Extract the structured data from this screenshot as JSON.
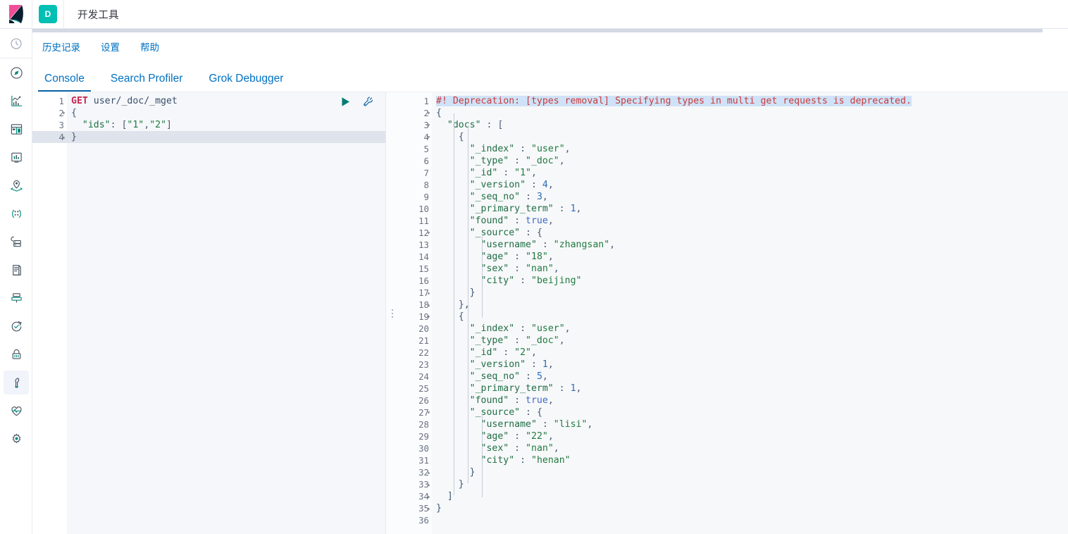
{
  "header": {
    "logo_icon": "kibana-logo",
    "app_badge": "D",
    "title": "开发工具"
  },
  "rail": {
    "items": [
      {
        "icon": "clock-icon",
        "name": "recently-viewed"
      },
      {
        "icon": "compass-icon",
        "name": "discover"
      },
      {
        "icon": "line-chart-icon",
        "name": "visualize"
      },
      {
        "icon": "dashboard-icon",
        "name": "dashboard"
      },
      {
        "icon": "canvas-icon",
        "name": "canvas"
      },
      {
        "icon": "maps-icon",
        "name": "maps"
      },
      {
        "icon": "ml-icon",
        "name": "machine-learning"
      },
      {
        "icon": "infrastructure-icon",
        "name": "infrastructure"
      },
      {
        "icon": "logs-icon",
        "name": "logs"
      },
      {
        "icon": "apm-icon",
        "name": "apm"
      },
      {
        "icon": "uptime-icon",
        "name": "uptime"
      },
      {
        "icon": "lock-icon",
        "name": "security"
      },
      {
        "icon": "wrench-icon",
        "name": "dev-tools",
        "active": true
      },
      {
        "icon": "heartbeat-icon",
        "name": "stack-monitoring"
      },
      {
        "icon": "gear-icon",
        "name": "management"
      }
    ]
  },
  "navlinks": [
    {
      "label": "历史记录",
      "name": "history-link"
    },
    {
      "label": "设置",
      "name": "settings-link"
    },
    {
      "label": "帮助",
      "name": "help-link"
    }
  ],
  "tabs": [
    {
      "label": "Console",
      "name": "tab-console",
      "active": true
    },
    {
      "label": "Search Profiler",
      "name": "tab-search-profiler",
      "active": false
    },
    {
      "label": "Grok Debugger",
      "name": "tab-grok-debugger",
      "active": false
    }
  ],
  "actions": {
    "run_label": "play-icon",
    "wrench_label": "wrench-icon"
  },
  "request_editor": {
    "name": "request-editor",
    "active_line": 4,
    "lines": [
      {
        "n": 1,
        "fold": "",
        "tokens": [
          {
            "t": "method",
            "v": "GET"
          },
          {
            "t": "url",
            "v": " user/_doc/_mget"
          }
        ]
      },
      {
        "n": 2,
        "fold": "▾",
        "tokens": [
          {
            "t": "brace",
            "v": "{"
          }
        ]
      },
      {
        "n": 3,
        "fold": "",
        "tokens": [
          {
            "t": "punc",
            "v": "  "
          },
          {
            "t": "key",
            "v": "\"ids\""
          },
          {
            "t": "punc",
            "v": ": ["
          },
          {
            "t": "str",
            "v": "\"1\""
          },
          {
            "t": "punc",
            "v": ","
          },
          {
            "t": "str",
            "v": "\"2\""
          },
          {
            "t": "punc",
            "v": "]"
          }
        ]
      },
      {
        "n": 4,
        "fold": "▴",
        "tokens": [
          {
            "t": "brace",
            "v": "}"
          }
        ]
      }
    ]
  },
  "response_editor": {
    "name": "response-editor",
    "selected_line": 1,
    "lines": [
      {
        "n": 1,
        "fold": "",
        "sel": true,
        "tokens": [
          {
            "t": "depr",
            "v": "#! Deprecation: [types removal] Specifying types in multi get requests is deprecated."
          }
        ]
      },
      {
        "n": 2,
        "fold": "▾",
        "tokens": [
          {
            "t": "brace",
            "v": "{"
          }
        ]
      },
      {
        "n": 3,
        "fold": "▾",
        "tokens": [
          {
            "t": "punc",
            "v": "  "
          },
          {
            "t": "key",
            "v": "\"docs\""
          },
          {
            "t": "punc",
            "v": " : ["
          }
        ]
      },
      {
        "n": 4,
        "fold": "▾",
        "tokens": [
          {
            "t": "punc",
            "v": "    "
          },
          {
            "t": "brace",
            "v": "{"
          }
        ]
      },
      {
        "n": 5,
        "fold": "",
        "tokens": [
          {
            "t": "punc",
            "v": "      "
          },
          {
            "t": "key",
            "v": "\"_index\""
          },
          {
            "t": "punc",
            "v": " : "
          },
          {
            "t": "str",
            "v": "\"user\""
          },
          {
            "t": "punc",
            "v": ","
          }
        ]
      },
      {
        "n": 6,
        "fold": "",
        "tokens": [
          {
            "t": "punc",
            "v": "      "
          },
          {
            "t": "key",
            "v": "\"_type\""
          },
          {
            "t": "punc",
            "v": " : "
          },
          {
            "t": "str",
            "v": "\"_doc\""
          },
          {
            "t": "punc",
            "v": ","
          }
        ]
      },
      {
        "n": 7,
        "fold": "",
        "tokens": [
          {
            "t": "punc",
            "v": "      "
          },
          {
            "t": "key",
            "v": "\"_id\""
          },
          {
            "t": "punc",
            "v": " : "
          },
          {
            "t": "str",
            "v": "\"1\""
          },
          {
            "t": "punc",
            "v": ","
          }
        ]
      },
      {
        "n": 8,
        "fold": "",
        "tokens": [
          {
            "t": "punc",
            "v": "      "
          },
          {
            "t": "key",
            "v": "\"_version\""
          },
          {
            "t": "punc",
            "v": " : "
          },
          {
            "t": "num",
            "v": "4"
          },
          {
            "t": "punc",
            "v": ","
          }
        ]
      },
      {
        "n": 9,
        "fold": "",
        "tokens": [
          {
            "t": "punc",
            "v": "      "
          },
          {
            "t": "key",
            "v": "\"_seq_no\""
          },
          {
            "t": "punc",
            "v": " : "
          },
          {
            "t": "num",
            "v": "3"
          },
          {
            "t": "punc",
            "v": ","
          }
        ]
      },
      {
        "n": 10,
        "fold": "",
        "tokens": [
          {
            "t": "punc",
            "v": "      "
          },
          {
            "t": "key",
            "v": "\"_primary_term\""
          },
          {
            "t": "punc",
            "v": " : "
          },
          {
            "t": "num",
            "v": "1"
          },
          {
            "t": "punc",
            "v": ","
          }
        ]
      },
      {
        "n": 11,
        "fold": "",
        "tokens": [
          {
            "t": "punc",
            "v": "      "
          },
          {
            "t": "key",
            "v": "\"found\""
          },
          {
            "t": "punc",
            "v": " : "
          },
          {
            "t": "bool",
            "v": "true"
          },
          {
            "t": "punc",
            "v": ","
          }
        ]
      },
      {
        "n": 12,
        "fold": "▾",
        "tokens": [
          {
            "t": "punc",
            "v": "      "
          },
          {
            "t": "key",
            "v": "\"_source\""
          },
          {
            "t": "punc",
            "v": " : "
          },
          {
            "t": "brace",
            "v": "{"
          }
        ]
      },
      {
        "n": 13,
        "fold": "",
        "tokens": [
          {
            "t": "punc",
            "v": "        "
          },
          {
            "t": "key",
            "v": "\"username\""
          },
          {
            "t": "punc",
            "v": " : "
          },
          {
            "t": "str",
            "v": "\"zhangsan\""
          },
          {
            "t": "punc",
            "v": ","
          }
        ]
      },
      {
        "n": 14,
        "fold": "",
        "tokens": [
          {
            "t": "punc",
            "v": "        "
          },
          {
            "t": "key",
            "v": "\"age\""
          },
          {
            "t": "punc",
            "v": " : "
          },
          {
            "t": "str",
            "v": "\"18\""
          },
          {
            "t": "punc",
            "v": ","
          }
        ]
      },
      {
        "n": 15,
        "fold": "",
        "tokens": [
          {
            "t": "punc",
            "v": "        "
          },
          {
            "t": "key",
            "v": "\"sex\""
          },
          {
            "t": "punc",
            "v": " : "
          },
          {
            "t": "str",
            "v": "\"nan\""
          },
          {
            "t": "punc",
            "v": ","
          }
        ]
      },
      {
        "n": 16,
        "fold": "",
        "tokens": [
          {
            "t": "punc",
            "v": "        "
          },
          {
            "t": "key",
            "v": "\"city\""
          },
          {
            "t": "punc",
            "v": " : "
          },
          {
            "t": "str",
            "v": "\"beijing\""
          }
        ]
      },
      {
        "n": 17,
        "fold": "▴",
        "tokens": [
          {
            "t": "punc",
            "v": "      "
          },
          {
            "t": "brace",
            "v": "}"
          }
        ]
      },
      {
        "n": 18,
        "fold": "▴",
        "tokens": [
          {
            "t": "punc",
            "v": "    "
          },
          {
            "t": "brace",
            "v": "},"
          }
        ]
      },
      {
        "n": 19,
        "fold": "▾",
        "tokens": [
          {
            "t": "punc",
            "v": "    "
          },
          {
            "t": "brace",
            "v": "{"
          }
        ]
      },
      {
        "n": 20,
        "fold": "",
        "tokens": [
          {
            "t": "punc",
            "v": "      "
          },
          {
            "t": "key",
            "v": "\"_index\""
          },
          {
            "t": "punc",
            "v": " : "
          },
          {
            "t": "str",
            "v": "\"user\""
          },
          {
            "t": "punc",
            "v": ","
          }
        ]
      },
      {
        "n": 21,
        "fold": "",
        "tokens": [
          {
            "t": "punc",
            "v": "      "
          },
          {
            "t": "key",
            "v": "\"_type\""
          },
          {
            "t": "punc",
            "v": " : "
          },
          {
            "t": "str",
            "v": "\"_doc\""
          },
          {
            "t": "punc",
            "v": ","
          }
        ]
      },
      {
        "n": 22,
        "fold": "",
        "tokens": [
          {
            "t": "punc",
            "v": "      "
          },
          {
            "t": "key",
            "v": "\"_id\""
          },
          {
            "t": "punc",
            "v": " : "
          },
          {
            "t": "str",
            "v": "\"2\""
          },
          {
            "t": "punc",
            "v": ","
          }
        ]
      },
      {
        "n": 23,
        "fold": "",
        "tokens": [
          {
            "t": "punc",
            "v": "      "
          },
          {
            "t": "key",
            "v": "\"_version\""
          },
          {
            "t": "punc",
            "v": " : "
          },
          {
            "t": "num",
            "v": "1"
          },
          {
            "t": "punc",
            "v": ","
          }
        ]
      },
      {
        "n": 24,
        "fold": "",
        "tokens": [
          {
            "t": "punc",
            "v": "      "
          },
          {
            "t": "key",
            "v": "\"_seq_no\""
          },
          {
            "t": "punc",
            "v": " : "
          },
          {
            "t": "num",
            "v": "5"
          },
          {
            "t": "punc",
            "v": ","
          }
        ]
      },
      {
        "n": 25,
        "fold": "",
        "tokens": [
          {
            "t": "punc",
            "v": "      "
          },
          {
            "t": "key",
            "v": "\"_primary_term\""
          },
          {
            "t": "punc",
            "v": " : "
          },
          {
            "t": "num",
            "v": "1"
          },
          {
            "t": "punc",
            "v": ","
          }
        ]
      },
      {
        "n": 26,
        "fold": "",
        "tokens": [
          {
            "t": "punc",
            "v": "      "
          },
          {
            "t": "key",
            "v": "\"found\""
          },
          {
            "t": "punc",
            "v": " : "
          },
          {
            "t": "bool",
            "v": "true"
          },
          {
            "t": "punc",
            "v": ","
          }
        ]
      },
      {
        "n": 27,
        "fold": "▾",
        "tokens": [
          {
            "t": "punc",
            "v": "      "
          },
          {
            "t": "key",
            "v": "\"_source\""
          },
          {
            "t": "punc",
            "v": " : "
          },
          {
            "t": "brace",
            "v": "{"
          }
        ]
      },
      {
        "n": 28,
        "fold": "",
        "tokens": [
          {
            "t": "punc",
            "v": "        "
          },
          {
            "t": "key",
            "v": "\"username\""
          },
          {
            "t": "punc",
            "v": " : "
          },
          {
            "t": "str",
            "v": "\"lisi\""
          },
          {
            "t": "punc",
            "v": ","
          }
        ]
      },
      {
        "n": 29,
        "fold": "",
        "tokens": [
          {
            "t": "punc",
            "v": "        "
          },
          {
            "t": "key",
            "v": "\"age\""
          },
          {
            "t": "punc",
            "v": " : "
          },
          {
            "t": "str",
            "v": "\"22\""
          },
          {
            "t": "punc",
            "v": ","
          }
        ]
      },
      {
        "n": 30,
        "fold": "",
        "tokens": [
          {
            "t": "punc",
            "v": "        "
          },
          {
            "t": "key",
            "v": "\"sex\""
          },
          {
            "t": "punc",
            "v": " : "
          },
          {
            "t": "str",
            "v": "\"nan\""
          },
          {
            "t": "punc",
            "v": ","
          }
        ]
      },
      {
        "n": 31,
        "fold": "",
        "tokens": [
          {
            "t": "punc",
            "v": "        "
          },
          {
            "t": "key",
            "v": "\"city\""
          },
          {
            "t": "punc",
            "v": " : "
          },
          {
            "t": "str",
            "v": "\"henan\""
          }
        ]
      },
      {
        "n": 32,
        "fold": "▴",
        "tokens": [
          {
            "t": "punc",
            "v": "      "
          },
          {
            "t": "brace",
            "v": "}"
          }
        ]
      },
      {
        "n": 33,
        "fold": "▴",
        "tokens": [
          {
            "t": "punc",
            "v": "    "
          },
          {
            "t": "brace",
            "v": "}"
          }
        ]
      },
      {
        "n": 34,
        "fold": "▴",
        "tokens": [
          {
            "t": "punc",
            "v": "  "
          },
          {
            "t": "brace",
            "v": "]"
          }
        ]
      },
      {
        "n": 35,
        "fold": "▴",
        "tokens": [
          {
            "t": "brace",
            "v": "}"
          }
        ]
      },
      {
        "n": 36,
        "fold": "",
        "tokens": [
          {
            "t": "punc",
            "v": ""
          }
        ]
      }
    ]
  },
  "colors": {
    "accent_teal": "#00bfb3",
    "link_blue": "#0071c2",
    "tab_active_underline": "#0b64a8",
    "deprecation_red": "#c93b3b",
    "method_pink": "#c7254e",
    "string_green": "#1f7a3f",
    "number_blue": "#2b6cb8",
    "editor_bg": "#f5f7fa",
    "selection_blue": "#cfe2f7"
  }
}
